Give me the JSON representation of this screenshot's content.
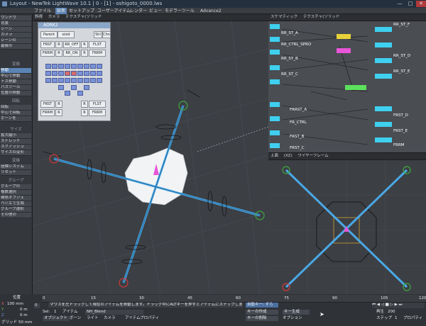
{
  "window": {
    "title": "Layout - NewTek LightWave 10.1 | 0 - [1] - oshigoto_0000.lws",
    "min_label": "—",
    "max_label": "□",
    "close_label": "✕"
  },
  "menu": [
    "ファイル",
    "編集",
    "セットアップ",
    "ユーザーアイテム",
    "レンダー",
    "ビュー",
    "モデラーツール",
    "Advance2"
  ],
  "left_panel": {
    "top_items": [
      "ワンドウ",
      "背景",
      "シーン",
      "カメラ",
      "シーンの",
      "最後の"
    ],
    "section1_title": "変換",
    "section1_items": [
      "移動",
      "中心で移動",
      "トス移動",
      "パスツール",
      "位置の移動"
    ],
    "section2_title": "回転",
    "section2_items": [
      "回転",
      "中心で回転",
      "ボーンを"
    ],
    "section3_title": "サイズ",
    "section3_items": [
      "拡大縮小",
      "ストレッチ",
      "スクアッシュ",
      "サイズの変形"
    ],
    "section4_title": "変換",
    "section4_items": [
      "座標システム",
      "リセット"
    ],
    "section5_title": "グループ",
    "section5_items": [
      "グループの",
      "複数選択",
      "関係オブジェ",
      "ベジエで生成",
      "グループ選択",
      "その他の"
    ]
  },
  "floating_panel": {
    "title": "ADRK2",
    "tab1": "Parent",
    "tab2": "sisid",
    "btn_a": "Shl",
    "btn_b": "Chn",
    "row1": [
      "FRST",
      "R",
      "RR_OFF",
      "R",
      "FLST"
    ],
    "row2": [
      "FRRM",
      "R",
      "RR_ON",
      "R",
      "FRRM"
    ],
    "row3": [
      "FRST",
      "R",
      "",
      "R",
      "FLST"
    ],
    "row4": [
      "FRRM",
      "R",
      "",
      "R",
      "FRRM"
    ]
  },
  "viewport_left": {
    "header": [
      "斜視",
      "カメラ",
      "テクスチャ(ソリッド"
    ]
  },
  "viewport_tr": {
    "header": [
      "スケマティック",
      "テクスチャ(ソリッド"
    ],
    "nodes": [
      "RR_ST_A",
      "RR_CTRL_SPRO",
      "RR_ST_B",
      "RR_ST_C",
      "RR_ST_D",
      "RR_ST_E",
      "FRRST_A",
      "FR_CTRL",
      "FRST_B",
      "FRST_C",
      "FRST_D",
      "FRST_E",
      "FRRM",
      "RR_ST_F"
    ]
  },
  "viewport_br": {
    "header": [
      "上面",
      "(XZ)",
      "ワイヤーフレーム"
    ]
  },
  "timeline": {
    "label_position": "位置",
    "ticks": [
      "0",
      "15",
      "30",
      "45",
      "60",
      "75",
      "90",
      "105",
      "120"
    ],
    "x_label": "X",
    "y_label": "Y",
    "z_label": "Z",
    "x_val": "100 mm",
    "y_val": "0 m",
    "z_val": "0 m",
    "grid_label": "グリッド",
    "grid_val": "50 mm",
    "frame_start": "0",
    "frame_current": "0",
    "status": "マウスを左ドラッグして現在のアイテムを移動します。ドラッグ中にALTキーを押すとアイテムにスナップします",
    "current_item_label": "アイテム",
    "current_item": "NH_Blend",
    "sel_label": "Sel:",
    "sel_val": "1",
    "auto_key": "自動キー: ずら",
    "keys_create": "キーの作成",
    "keys_delete": "キーの削除",
    "keys_label": "キー生成",
    "properties": "プロパティ",
    "play_label": "再生",
    "bones_label": "ボーン",
    "lights_label": "ライト",
    "cameras_label": "カメラ",
    "objects_label": "オブジェクト",
    "properties2": "アイテムプロパティ",
    "options": "オプション",
    "end_frame": "200",
    "fps_label": "ステップ",
    "fps": "1"
  },
  "colors": {
    "accent": "#5b84b5",
    "bone": "#4aa8e6",
    "node_cyan": "#3fd0f0",
    "node_yellow": "#e8d23a",
    "node_pink": "#e855d8",
    "node_green": "#5ce05c"
  }
}
